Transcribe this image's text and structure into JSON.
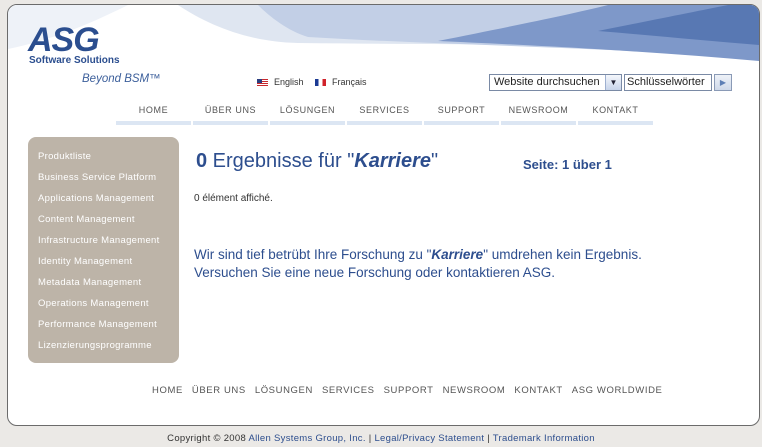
{
  "brand": {
    "name": "ASG",
    "subtitle": "Software Solutions",
    "tagline": "Beyond BSM™",
    "color": "#2b4e8f"
  },
  "languages": [
    {
      "label": "English",
      "icon": "us-flag-icon"
    },
    {
      "label": "Français",
      "icon": "france-flag-icon"
    }
  ],
  "search": {
    "scope_value": "Website durchsuchen",
    "keyword_value": "Schlüsselwörter",
    "go_icon": "arrow-right-icon"
  },
  "nav": [
    "HOME",
    "ÜBER UNS",
    "LÖSUNGEN",
    "SERVICES",
    "SUPPORT",
    "NEWSROOM",
    "KONTAKT"
  ],
  "sidebar": {
    "items": [
      "Produktliste",
      "Business Service Platform",
      "Applications Management",
      "Content Management",
      "Infrastructure Management",
      "Identity Management",
      "Metadata Management",
      "Operations Management",
      "Performance Management",
      "Lizenzierungsprogramme"
    ],
    "color": "#bdb4a8"
  },
  "results": {
    "count": "0",
    "title_text": " Ergebnisse für \"",
    "query": "Karriere",
    "title_end": "\"",
    "pages": "Seite: 1 über 1",
    "shown": "0 élément affiché.",
    "message_start": "Wir sind tief betrübt Ihre Forschung zu \"",
    "message_end": "\" umdrehen kein Ergebnis. Versuchen Sie eine neue Forschung oder kontaktieren ASG."
  },
  "footer_nav": [
    "HOME",
    "ÜBER UNS",
    "LÖSUNGEN",
    "SERVICES",
    "SUPPORT",
    "NEWSROOM",
    "KONTAKT",
    "ASG WORLDWIDE"
  ],
  "copyright": {
    "prefix": "Copyright © 2008 ",
    "company": "Allen Systems Group, Inc.",
    "sep1": " | ",
    "legal": "Legal/Privacy Statement",
    "sep2": " | ",
    "trademark": "Trademark Information"
  }
}
